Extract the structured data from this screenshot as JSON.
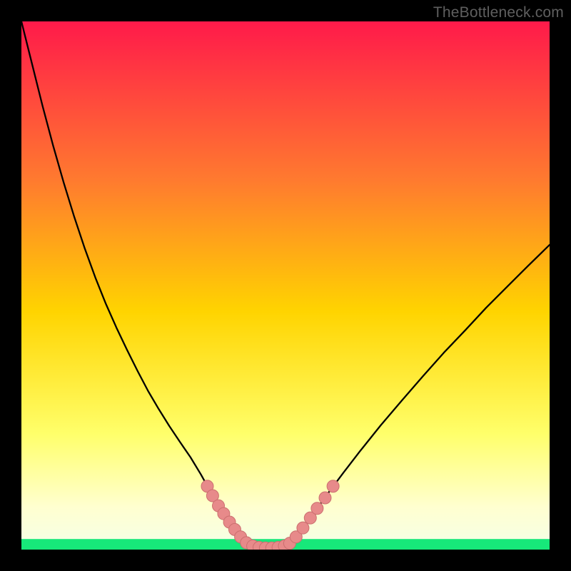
{
  "watermark": "TheBottleneck.com",
  "colors": {
    "background": "#000000",
    "gradient_top": "#ff1a4a",
    "gradient_mid1": "#ff7a2f",
    "gradient_mid2": "#ffd400",
    "gradient_low": "#ffff6a",
    "gradient_pale": "#ffffd0",
    "green_band": "#17e87a",
    "curve": "#000000",
    "marker_fill": "#e78a8a",
    "marker_stroke": "#cc6f6f",
    "watermark": "#5f5f5f"
  },
  "chart_data": {
    "type": "line",
    "title": "",
    "xlabel": "",
    "ylabel": "",
    "xlim": [
      0,
      100
    ],
    "ylim": [
      0,
      100
    ],
    "series": [
      {
        "name": "left-branch",
        "x": [
          0,
          2,
          4,
          6,
          8,
          10,
          12,
          14,
          16,
          18,
          20,
          22,
          24,
          26,
          28,
          30,
          32,
          34,
          35.5,
          37,
          38.5,
          40,
          41.5,
          43
        ],
        "y": [
          100,
          92,
          84,
          76.5,
          69.5,
          63,
          57,
          51.5,
          46.5,
          42,
          37.8,
          33.8,
          30,
          26.6,
          23.4,
          20.4,
          17.5,
          14.2,
          11.5,
          9,
          6.5,
          4.2,
          2.2,
          0.7
        ]
      },
      {
        "name": "valley-floor",
        "x": [
          43,
          44.5,
          46,
          47.5,
          49,
          50.5
        ],
        "y": [
          0.7,
          0.4,
          0.3,
          0.3,
          0.4,
          0.7
        ]
      },
      {
        "name": "right-branch",
        "x": [
          50.5,
          52,
          54,
          56,
          58,
          61,
          64,
          68,
          72,
          76,
          80,
          84,
          88,
          92,
          96,
          100
        ],
        "y": [
          0.7,
          2.4,
          5,
          7.8,
          10.6,
          14.6,
          18.5,
          23.5,
          28.2,
          32.8,
          37.3,
          41.5,
          45.8,
          49.8,
          53.8,
          57.7
        ]
      }
    ],
    "markers": [
      {
        "x": 35.2,
        "y": 12.0
      },
      {
        "x": 36.2,
        "y": 10.2
      },
      {
        "x": 37.3,
        "y": 8.3
      },
      {
        "x": 38.3,
        "y": 6.8
      },
      {
        "x": 39.4,
        "y": 5.2
      },
      {
        "x": 40.4,
        "y": 3.8
      },
      {
        "x": 41.5,
        "y": 2.4
      },
      {
        "x": 42.6,
        "y": 1.3
      },
      {
        "x": 43.8,
        "y": 0.7
      },
      {
        "x": 45.0,
        "y": 0.4
      },
      {
        "x": 46.2,
        "y": 0.3
      },
      {
        "x": 47.4,
        "y": 0.3
      },
      {
        "x": 48.6,
        "y": 0.4
      },
      {
        "x": 49.8,
        "y": 0.7
      },
      {
        "x": 50.8,
        "y": 1.2
      },
      {
        "x": 52.0,
        "y": 2.4
      },
      {
        "x": 53.3,
        "y": 4.1
      },
      {
        "x": 54.7,
        "y": 6.0
      },
      {
        "x": 56.0,
        "y": 7.8
      },
      {
        "x": 57.5,
        "y": 9.8
      },
      {
        "x": 59.0,
        "y": 12.0
      }
    ],
    "green_band_y": [
      0,
      2.0
    ]
  }
}
